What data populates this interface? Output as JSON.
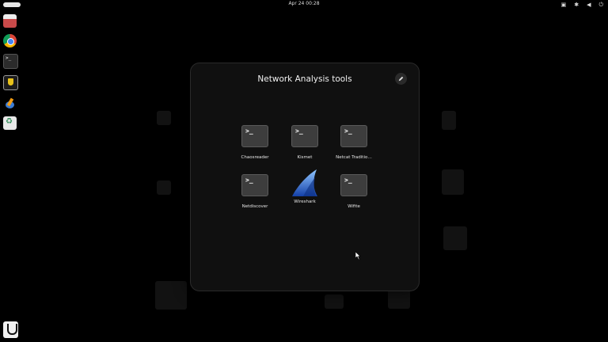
{
  "topbar": {
    "clock": "Apr 24  00:28",
    "tray_icons": [
      "network-icon",
      "bluetooth-icon",
      "volume-icon",
      "power-icon"
    ]
  },
  "dash": {
    "items": [
      "files-icon",
      "chrome-icon",
      "terminal-icon",
      "vault-icon",
      "paint-icon",
      "trash-icon"
    ],
    "bottom_item": "kali-app-grid-icon"
  },
  "folder": {
    "title": "Network Analysis tools",
    "apps": [
      {
        "label": "Chaosreader",
        "icon": "terminal-app-icon"
      },
      {
        "label": "Kismet",
        "icon": "terminal-app-icon"
      },
      {
        "label": "Netcat Traditio…",
        "icon": "terminal-app-icon"
      },
      {
        "label": "Netdiscover",
        "icon": "terminal-app-icon"
      },
      {
        "label": "Wireshark",
        "icon": "wireshark-icon"
      },
      {
        "label": "Wifite",
        "icon": "terminal-app-icon"
      }
    ],
    "prompt_glyph": ">_"
  }
}
